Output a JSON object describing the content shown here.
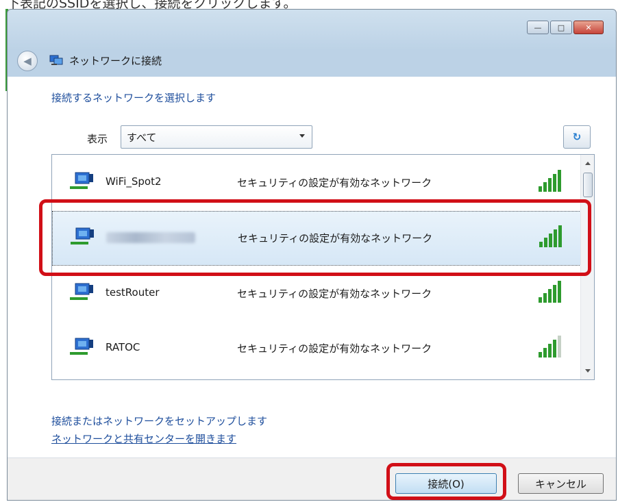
{
  "caption": "下表記のSSIDを選択し、接続をクリックします。",
  "window": {
    "title": "ネットワークに接続",
    "minimize_label": "—",
    "maximize_label": "□",
    "close_label": "✕"
  },
  "heading": "接続するネットワークを選択します",
  "filter": {
    "label": "表示",
    "selected": "すべて"
  },
  "refresh_label": "↻",
  "networks": [
    {
      "name": "WiFi_Spot2",
      "security": "セキュリティの設定が有効なネットワーク",
      "signal_bars": 5,
      "selected": false,
      "obscured": false
    },
    {
      "name": "",
      "security": "セキュリティの設定が有効なネットワーク",
      "signal_bars": 5,
      "selected": true,
      "obscured": true
    },
    {
      "name": "testRouter",
      "security": "セキュリティの設定が有効なネットワーク",
      "signal_bars": 5,
      "selected": false,
      "obscured": false
    },
    {
      "name": "RATOC",
      "security": "セキュリティの設定が有効なネットワーク",
      "signal_bars": 4,
      "selected": false,
      "obscured": false
    }
  ],
  "links": {
    "setup": "接続またはネットワークをセットアップします",
    "sharing_center": "ネットワークと共有センターを開きます"
  },
  "buttons": {
    "connect": "接続(O)",
    "cancel": "キャンセル"
  },
  "colors": {
    "highlight": "#d10f17",
    "link": "#1e4e9c",
    "signal": "#2e9b2e"
  }
}
